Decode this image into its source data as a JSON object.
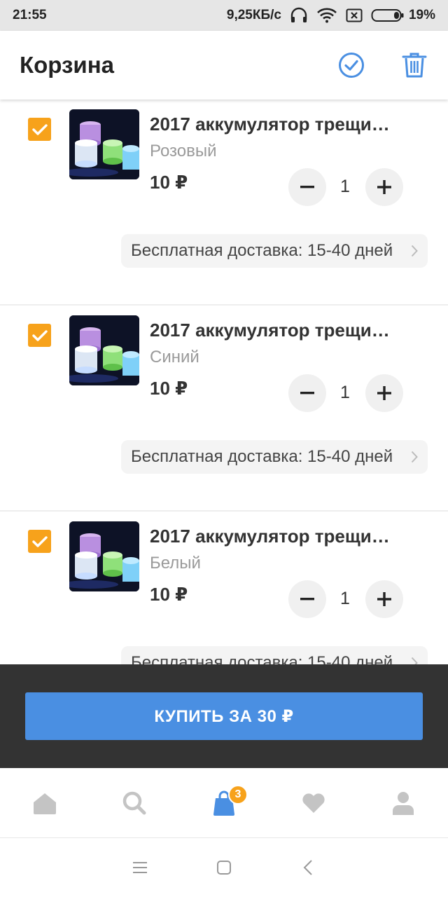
{
  "status_bar": {
    "time": "21:55",
    "network_speed": "9,25КБ/с",
    "battery_percent": "19%",
    "battery_level": 0.19,
    "icons": [
      "headphones-icon",
      "wifi-icon",
      "no-sim-icon",
      "battery-icon"
    ]
  },
  "header": {
    "title": "Корзина",
    "actions": [
      "select-all-check-icon",
      "trash-icon"
    ]
  },
  "colors": {
    "accent_blue": "#4a8fe2",
    "checkbox_orange": "#f7a21b",
    "buy_bar_bg": "#333333"
  },
  "cart": {
    "items": [
      {
        "title": "2017 аккумулятор трещи…",
        "variant": "Розовый",
        "price": "10 ₽",
        "quantity": "1",
        "delivery": "Бесплатная доставка: 15-40 дней",
        "checked": true
      },
      {
        "title": "2017 аккумулятор трещи…",
        "variant": "Синий",
        "price": "10 ₽",
        "quantity": "1",
        "delivery": "Бесплатная доставка: 15-40 дней",
        "checked": true
      },
      {
        "title": "2017 аккумулятор трещи…",
        "variant": "Белый",
        "price": "10 ₽",
        "quantity": "1",
        "delivery": "Бесплатная доставка: 15-40 дней",
        "checked": true
      }
    ]
  },
  "buy": {
    "label": "КУПИТЬ ЗА 30 ₽"
  },
  "bottom_nav": {
    "items": [
      "home-icon",
      "search-icon",
      "cart-bag-icon",
      "heart-icon",
      "profile-icon"
    ],
    "cart_badge": "3",
    "active": "cart-bag-icon"
  },
  "system_nav": [
    "menu-icon",
    "home-square-icon",
    "back-icon"
  ]
}
